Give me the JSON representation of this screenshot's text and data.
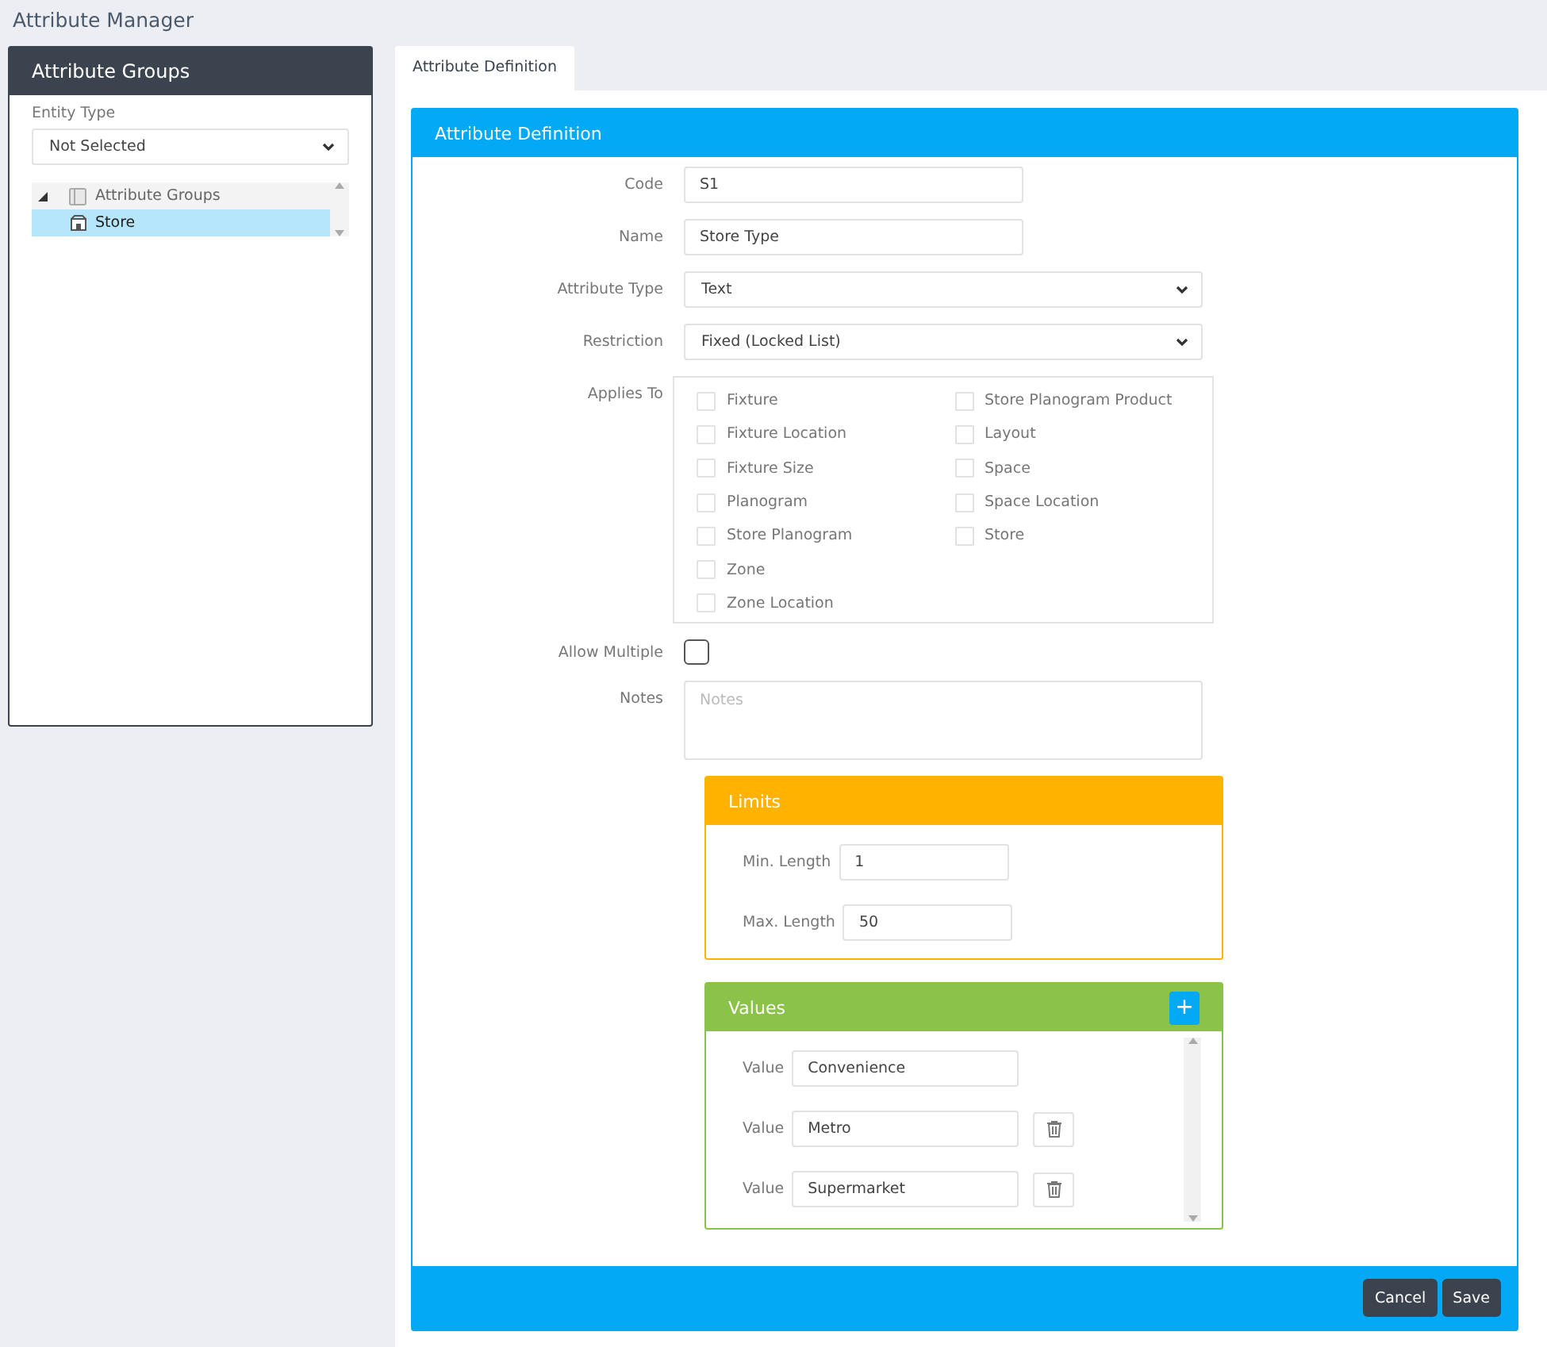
{
  "page_title": "Attribute Manager",
  "sidebar": {
    "title": "Attribute Groups",
    "entity_type": {
      "label": "Entity Type",
      "value": "Not Selected"
    },
    "tree": [
      {
        "label": "Attribute Groups",
        "expanded": true,
        "selected": false,
        "children": [
          {
            "label": "Store",
            "selected": true
          }
        ]
      }
    ]
  },
  "tabs": [
    {
      "label": "Attribute Definition",
      "selected": true
    }
  ],
  "form": {
    "title": "Attribute Definition",
    "code": {
      "label": "Code",
      "value": "S1"
    },
    "name": {
      "label": "Name",
      "value": "Store Type"
    },
    "attribute_type": {
      "label": "Attribute Type",
      "value": "Text"
    },
    "restriction": {
      "label": "Restriction",
      "value": "Fixed (Locked List)"
    },
    "applies_to": {
      "label": "Applies To",
      "columns": [
        [
          {
            "label": "Fixture",
            "checked": false
          },
          {
            "label": "Fixture Location",
            "checked": false
          },
          {
            "label": "Fixture Size",
            "checked": false
          },
          {
            "label": "Planogram",
            "checked": false
          },
          {
            "label": "Store Planogram",
            "checked": false
          },
          {
            "label": "Zone",
            "checked": false
          },
          {
            "label": "Zone Location",
            "checked": false
          }
        ],
        [
          {
            "label": "Store Planogram Product",
            "checked": false
          },
          {
            "label": "Layout",
            "checked": false
          },
          {
            "label": "Space",
            "checked": false
          },
          {
            "label": "Space Location",
            "checked": false
          },
          {
            "label": "Store",
            "checked": false
          }
        ]
      ]
    },
    "allow_multiple": {
      "label": "Allow Multiple",
      "checked": false
    },
    "notes": {
      "label": "Notes",
      "placeholder": "Notes"
    },
    "limits": {
      "title": "Limits",
      "fields": [
        {
          "label": "Min. Length",
          "value": "1"
        },
        {
          "label": "Max. Length",
          "value": "50"
        }
      ]
    },
    "values": {
      "title": "Values",
      "add": "+",
      "items": [
        {
          "label": "Value",
          "value": "Convenience",
          "removable": false
        },
        {
          "label": "Value",
          "value": "Metro",
          "removable": true
        },
        {
          "label": "Value",
          "value": "Supermarket",
          "removable": true
        }
      ]
    },
    "buttons": [
      "Cancel",
      "Save"
    ]
  }
}
